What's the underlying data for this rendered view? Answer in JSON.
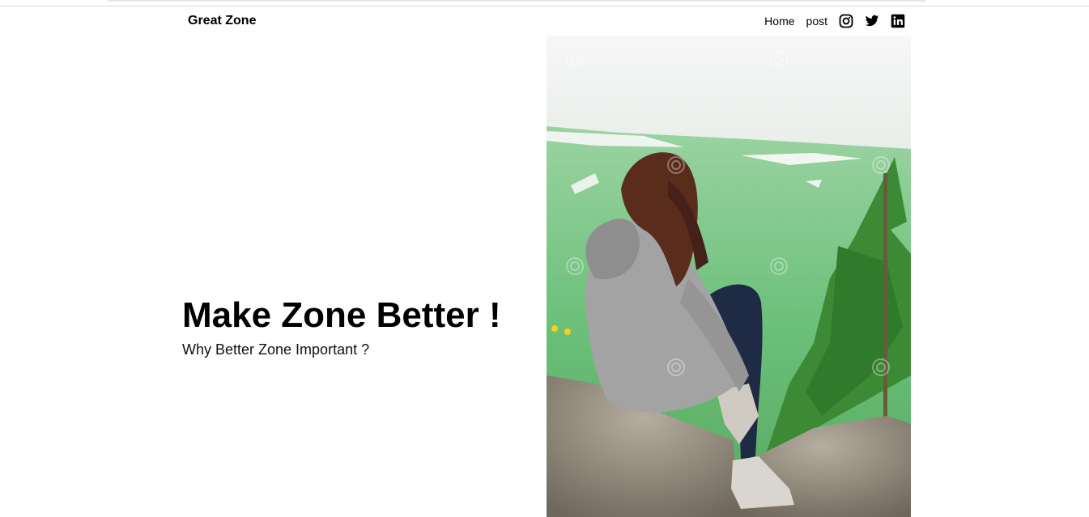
{
  "nav": {
    "brand": "Great Zone",
    "links": [
      "Home",
      "post"
    ],
    "social_icons": [
      "instagram-icon",
      "twitter-icon",
      "linkedin-icon"
    ]
  },
  "hero": {
    "title": "Make Zone Better !",
    "subtitle": "Why Better Zone Important ?",
    "image_description": "person-in-hoodie-sitting-on-rock-overlooking-valley"
  },
  "colors": {
    "text": "#000000",
    "background": "#ffffff",
    "sky": "#f3f5f3",
    "valley_green": "#7fc989",
    "tree_green": "#3f8f3a",
    "hoodie_gray": "#9e9e9e",
    "rock_gray": "#8c8577"
  }
}
